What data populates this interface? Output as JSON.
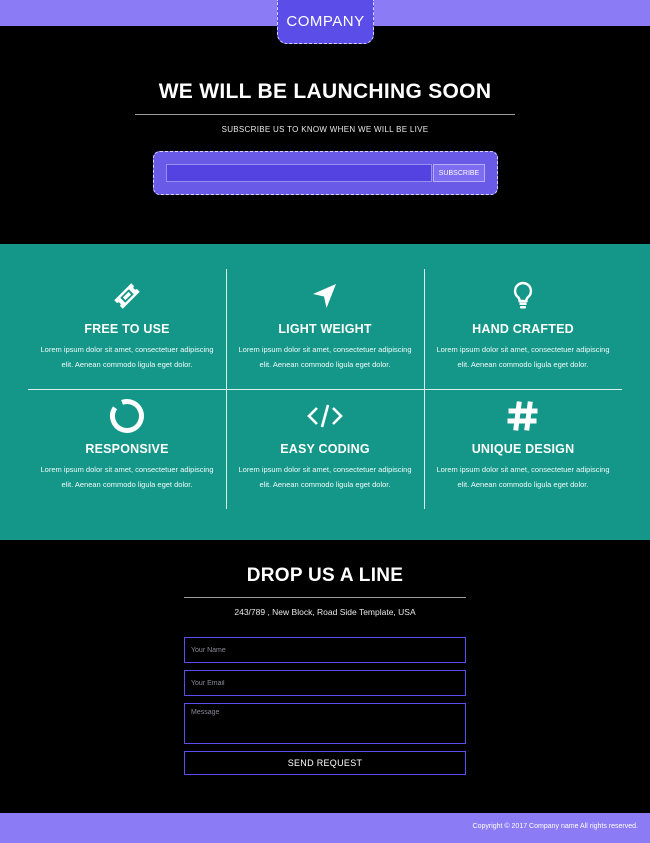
{
  "header": {
    "brand": "COMPANY",
    "colors": {
      "bar": "#8b7cf6",
      "tab": "#5b4de8"
    }
  },
  "hero": {
    "title": "WE WILL BE LAUNCHING SOON",
    "subtitle": "SUBSCRIBE US TO KNOW WHEN WE WILL BE LIVE",
    "email_value": "",
    "subscribe_label": "SUBSCRIBE"
  },
  "features": {
    "background": "#149688",
    "items": [
      {
        "icon": "ticket-icon",
        "title": "FREE TO USE",
        "text": "Lorem ipsum dolor sit amet, consectetuer adipiscing elit. Aenean commodo ligula eget dolor."
      },
      {
        "icon": "location-arrow-icon",
        "title": "LIGHT WEIGHT",
        "text": "Lorem ipsum dolor sit amet, consectetuer adipiscing elit. Aenean commodo ligula eget dolor."
      },
      {
        "icon": "lightbulb-icon",
        "title": "HAND CRAFTED",
        "text": "Lorem ipsum dolor sit amet, consectetuer adipiscing elit. Aenean commodo ligula eget dolor."
      },
      {
        "icon": "ring-icon",
        "title": "RESPONSIVE",
        "text": "Lorem ipsum dolor sit amet, consectetuer adipiscing elit. Aenean commodo ligula eget dolor."
      },
      {
        "icon": "code-icon",
        "title": "EASY CODING",
        "text": "Lorem ipsum dolor sit amet, consectetuer adipiscing elit. Aenean commodo ligula eget dolor."
      },
      {
        "icon": "hashtag-icon",
        "title": "UNIQUE DESIGN",
        "text": "Lorem ipsum dolor sit amet, consectetuer adipiscing elit. Aenean commodo ligula eget dolor."
      }
    ]
  },
  "contact": {
    "title": "DROP US A LINE",
    "address": "243/789 , New Block, Road Side Template, USA",
    "name_placeholder": "Your Name",
    "email_placeholder": "Your Email",
    "message_placeholder": "Message",
    "send_label": "SEND REQUEST"
  },
  "footer": {
    "copyright": "Copyright © 2017 Company name All rights reserved."
  }
}
